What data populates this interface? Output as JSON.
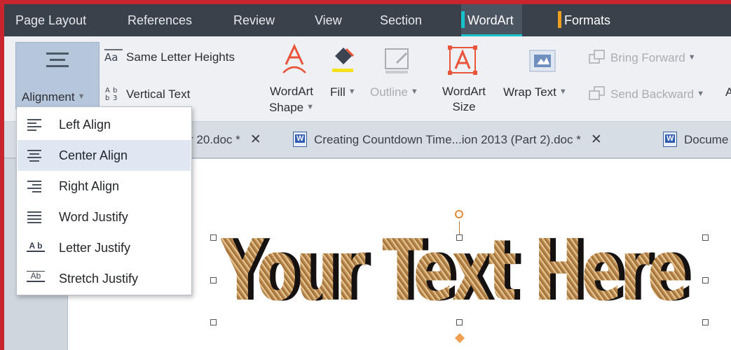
{
  "menu_tabs": [
    "Page Layout",
    "References",
    "Review",
    "View",
    "Section",
    "WordArt",
    "Formats"
  ],
  "ribbon": {
    "alignment_label": "Alignment",
    "same_letter_heights": "Same Letter Heights",
    "vertical_text": "Vertical Text",
    "wordart_shape_line1": "WordArt",
    "wordart_shape_line2": "Shape",
    "fill": "Fill",
    "outline": "Outline",
    "wordart_size_line1": "WordArt",
    "wordart_size_line2": "Size",
    "wrap_text": "Wrap Text",
    "bring_forward": "Bring Forward",
    "send_backward": "Send Backward",
    "cut_off_letter": "A"
  },
  "doc_tabs": [
    {
      "label": "r 20.doc *"
    },
    {
      "label": "Creating Countdown Time...ion 2013 (Part 2).doc *"
    },
    {
      "label": "Docume"
    }
  ],
  "alignment_menu": {
    "items": [
      {
        "label": "Left Align",
        "icon": "left-align-icon"
      },
      {
        "label": "Center Align",
        "icon": "center-align-icon",
        "highlighted": true
      },
      {
        "label": "Right Align",
        "icon": "right-align-icon"
      },
      {
        "label": "Word Justify",
        "icon": "word-justify-icon"
      },
      {
        "label": "Letter Justify",
        "icon": "letter-justify-icon"
      },
      {
        "label": "Stretch Justify",
        "icon": "stretch-justify-icon"
      }
    ]
  },
  "wordart": {
    "text": "Your Text Here"
  },
  "colors": {
    "menubar": "#39414b",
    "accent": "#19c1cc",
    "highlight": "#dfe7f3",
    "border_red": "#c8252f"
  }
}
